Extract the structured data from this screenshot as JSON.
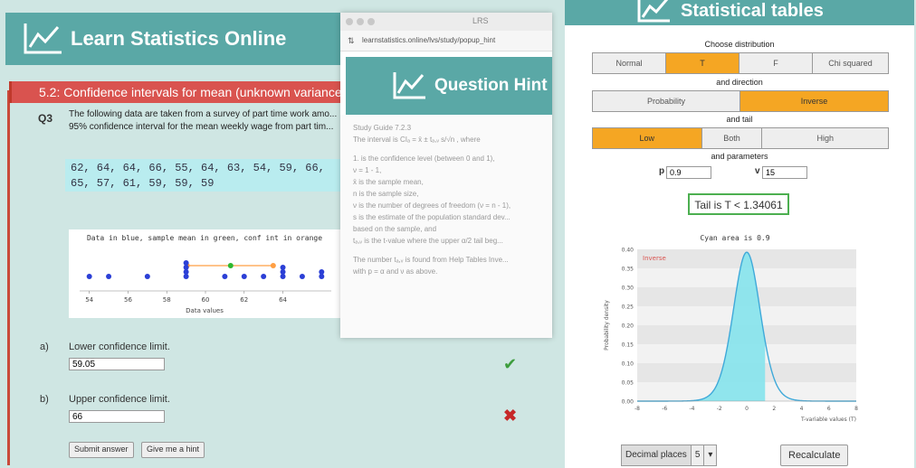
{
  "main": {
    "title": "Learn Statistics Online",
    "section": "5.2: Confidence intervals for mean (unknown variance)",
    "question_number": "Q3",
    "question_text": "The following data are taken from a survey of part time work amo... 95% confidence interval for the mean weekly wage from part tim...",
    "data_line1": "62, 64, 64, 66, 55, 64, 63, 54, 59, 66,",
    "data_line2": "65, 57, 61, 59, 59, 59",
    "plot": {
      "title": "Data in blue, sample mean in green, conf int in orange",
      "xlabel": "Data values",
      "x_ticks": [
        "54",
        "56",
        "58",
        "60",
        "62",
        "64"
      ]
    },
    "part_a": {
      "label": "a)",
      "text": "Lower confidence limit.",
      "value": "59.05"
    },
    "part_b": {
      "label": "b)",
      "text": "Upper confidence limit.",
      "value": "66"
    },
    "submit_label": "Submit answer",
    "hint_label": "Give me a hint",
    "check_icon": "✔",
    "cross_icon": "✖"
  },
  "popup": {
    "window_title": "LRS",
    "url": "learnstatistics.online/lvs/study/popup_hint",
    "header_title": "Question Hint",
    "body": [
      "Study Guide 7.2.3",
      "The interval is CIₐ = x̄ ± tₐ,ᵥ s/√n , where",
      "",
      "1. is the confidence level (between 0 and 1),",
      "ν = 1 - 1,",
      "x̄ is the sample mean,",
      "n is the sample size,",
      "ν is the number of degrees of freedom (ν = n - 1),",
      "s is the estimate of the population standard dev...",
      "based on the sample, and",
      "tₐ,ᵥ is the t-value where the upper α/2 tail beg...",
      "",
      "The number tₐ,ᵥ is found from Help Tables Inve...",
      "with p = α and ν as above."
    ]
  },
  "stats": {
    "title": "Statistical tables",
    "choose_distribution": "Choose distribution",
    "distributions": [
      "Normal",
      "T",
      "F",
      "Chi squared"
    ],
    "distribution_selected": 1,
    "and_direction": "and direction",
    "directions": [
      "Probability",
      "Inverse"
    ],
    "direction_selected": 1,
    "and_tail": "and tail",
    "tails": [
      "Low",
      "Both",
      "High"
    ],
    "tail_selected": 0,
    "and_parameters": "and parameters",
    "p_label": "p",
    "p_value": "0.9",
    "v_label": "v",
    "v_value": "15",
    "result": "Tail is T < 1.34061",
    "chart_title": "Cyan area is 0.9",
    "chart_legend": "Inverse",
    "chart_xlabel": "T-variable values (T)",
    "chart_ylabel": "Probability density",
    "decimal_label": "Decimal places",
    "decimal_value": "5",
    "recalc_label": "Recalculate",
    "colors": {
      "accent": "#5aa8a6",
      "selected": "#f5a623",
      "result_border": "#4caf50",
      "curve": "#3fa9d9",
      "fill": "#7fe3ec"
    }
  },
  "chart_data": [
    {
      "type": "scatter",
      "title": "Data in blue, sample mean in green, conf int in orange",
      "xlabel": "Data values",
      "x_ticks": [
        54,
        56,
        58,
        60,
        62,
        64
      ],
      "xlim": [
        53.5,
        66.5
      ],
      "series": [
        {
          "name": "Data",
          "values": [
            54,
            55,
            57,
            59,
            59,
            59,
            59,
            61,
            62,
            63,
            64,
            64,
            64,
            65,
            66,
            66
          ]
        },
        {
          "name": "Sample mean",
          "values": [
            61.3
          ]
        },
        {
          "name": "Confidence interval",
          "values": [
            59.05,
            63.5
          ]
        }
      ]
    },
    {
      "type": "area",
      "title": "Cyan area is 0.9",
      "xlabel": "T-variable values (T)",
      "ylabel": "Probability density",
      "x_ticks": [
        -8,
        -6,
        -4,
        -2,
        0,
        2,
        4,
        6,
        8
      ],
      "y_ticks": [
        0.0,
        0.05,
        0.1,
        0.15,
        0.2,
        0.25,
        0.3,
        0.35,
        0.4
      ],
      "xlim": [
        -8,
        8
      ],
      "ylim": [
        0,
        0.4
      ],
      "df": 15,
      "shaded_upper": 1.34061
    }
  ]
}
